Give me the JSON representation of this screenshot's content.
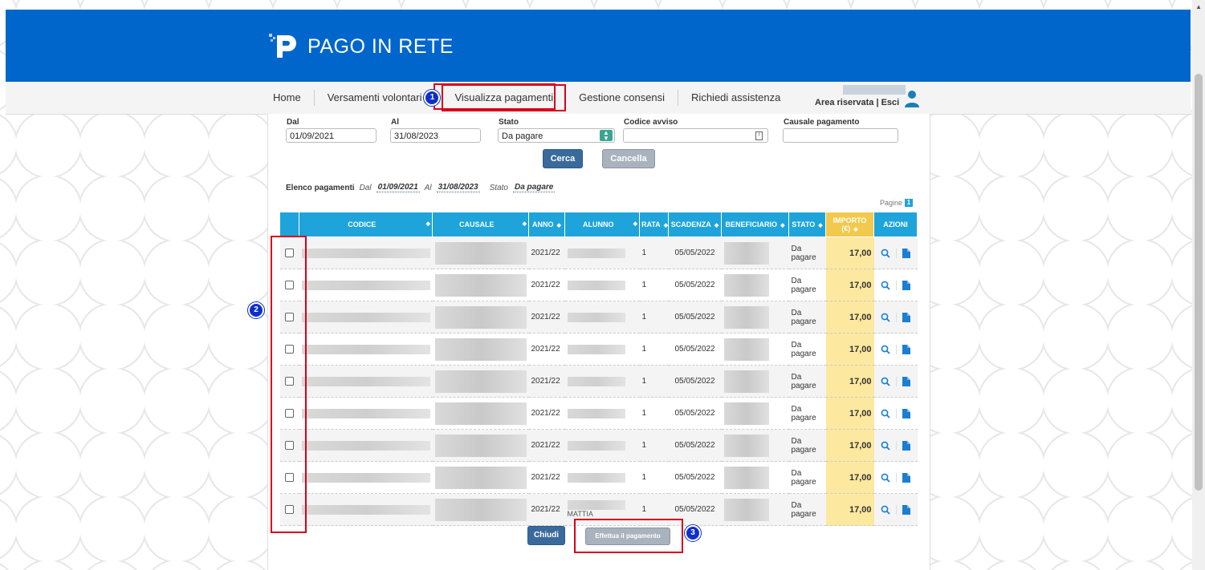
{
  "header": {
    "app_title": "PAGO IN RETE"
  },
  "nav": {
    "items": [
      {
        "label": "Home"
      },
      {
        "label": "Versamenti volontari"
      },
      {
        "label": "Visualizza pagamenti"
      },
      {
        "label": "Gestione consensi"
      },
      {
        "label": "Richiedi assistenza"
      }
    ]
  },
  "user": {
    "links": "Area riservata | Esci"
  },
  "markers": {
    "m1": "1",
    "m2": "2",
    "m3": "3"
  },
  "filters": {
    "dal_label": "Dal",
    "dal_value": "01/09/2021",
    "al_label": "Al",
    "al_value": "31/08/2023",
    "stato_label": "Stato",
    "stato_value": "Da pagare",
    "codice_label": "Codice avviso",
    "codice_value": "",
    "causale_label": "Causale pagamento",
    "causale_value": ""
  },
  "buttons": {
    "cerca": "Cerca",
    "cancella": "Cancella",
    "chiudi": "Chiudi",
    "effettua": "Effettua il pagamento"
  },
  "summary": {
    "title": "Elenco pagamenti",
    "dal_label": "Dal",
    "dal": "01/09/2021",
    "al_label": "Al",
    "al": "31/08/2023",
    "stato_label": "Stato",
    "stato": "Da pagare"
  },
  "pagination": {
    "label": "Pagine",
    "current": "1"
  },
  "table": {
    "headers": [
      "CODICE",
      "CAUSALE",
      "ANNO",
      "ALUNNO",
      "RATA",
      "SCADENZA",
      "BENEFICIARIO",
      "STATO",
      "IMPORTO (€)",
      "AZIONI"
    ],
    "rows": [
      {
        "anno": "2021/22",
        "alunno": "",
        "rata": "1",
        "scadenza": "05/05/2022",
        "stato": "Da pagare",
        "importo": "17,00"
      },
      {
        "anno": "2021/22",
        "alunno": "",
        "rata": "1",
        "scadenza": "05/05/2022",
        "stato": "Da pagare",
        "importo": "17,00"
      },
      {
        "anno": "2021/22",
        "alunno": "",
        "rata": "1",
        "scadenza": "05/05/2022",
        "stato": "Da pagare",
        "importo": "17,00"
      },
      {
        "anno": "2021/22",
        "alunno": "",
        "rata": "1",
        "scadenza": "05/05/2022",
        "stato": "Da pagare",
        "importo": "17,00"
      },
      {
        "anno": "2021/22",
        "alunno": "",
        "rata": "1",
        "scadenza": "05/05/2022",
        "stato": "Da pagare",
        "importo": "17,00"
      },
      {
        "anno": "2021/22",
        "alunno": "",
        "rata": "1",
        "scadenza": "05/05/2022",
        "stato": "Da pagare",
        "importo": "17,00"
      },
      {
        "anno": "2021/22",
        "alunno": "",
        "rata": "1",
        "scadenza": "05/05/2022",
        "stato": "Da pagare",
        "importo": "17,00"
      },
      {
        "anno": "2021/22",
        "alunno": "",
        "rata": "1",
        "scadenza": "05/05/2022",
        "stato": "Da pagare",
        "importo": "17,00"
      },
      {
        "anno": "2021/22",
        "alunno": "MATTIA",
        "rata": "1",
        "scadenza": "05/05/2022",
        "stato": "Da pagare",
        "importo": "17,00"
      }
    ]
  },
  "colors": {
    "brand": "#0066cc",
    "table_header": "#1ea4da",
    "importo_header": "#f2c94c",
    "importo_cell": "#fde8a0",
    "highlight": "#d6001c",
    "marker": "#0d2fcf"
  },
  "icons": {
    "logo": "pagoinrete-logo-icon",
    "user": "user-icon",
    "search": "search-icon",
    "document": "document-icon",
    "sort": "sort-arrows-icon",
    "select": "select-arrows-icon",
    "calendar": "calendar-icon"
  }
}
